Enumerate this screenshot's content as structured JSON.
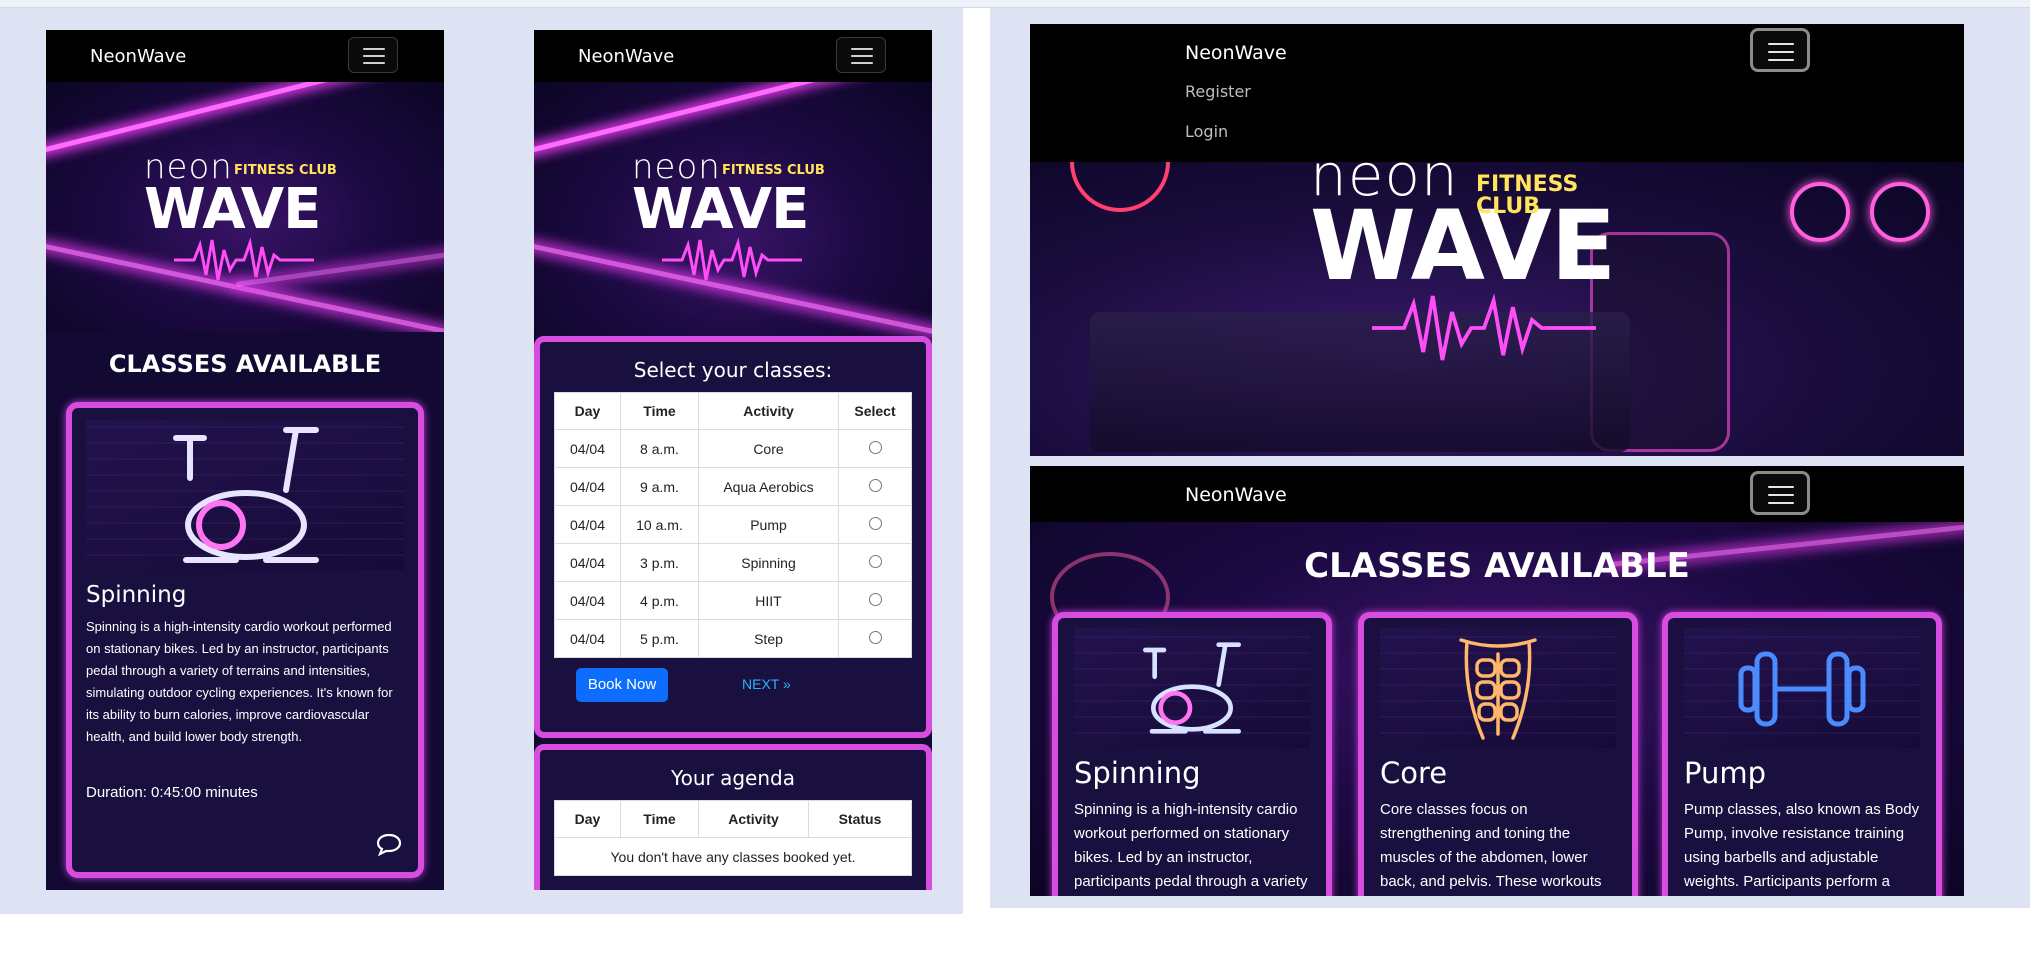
{
  "brand": "NeonWave",
  "logo": {
    "neon": "neon",
    "fitness_club": "FITNESS CLUB",
    "wave": "WAVE"
  },
  "nav_menu": {
    "register": "Register",
    "login": "Login"
  },
  "classes_heading": "CLASSES AVAILABLE",
  "classes": [
    {
      "title": "Spinning",
      "icon": "bike-icon",
      "description_full": "Spinning is a high-intensity cardio workout performed on stationary bikes. Led by an instructor, participants pedal through a variety of terrains and intensities, simulating outdoor cycling experiences. It's known for its ability to burn calories, improve cardiovascular health, and build lower body strength.",
      "description_short": "Spinning is a high-intensity cardio workout performed on stationary bikes. Led by an instructor, participants pedal through a variety",
      "duration": "Duration: 0:45:00 minutes"
    },
    {
      "title": "Core",
      "icon": "abs-icon",
      "description_short": "Core classes focus on strengthening and toning the muscles of the abdomen, lower back, and pelvis. These workouts"
    },
    {
      "title": "Pump",
      "icon": "dumbbell-icon",
      "description_short": "Pump classes, also known as Body Pump, involve resistance training using barbells and adjustable weights. Participants perform a"
    }
  ],
  "schedule": {
    "title": "Select your classes:",
    "headers": [
      "Day",
      "Time",
      "Activity",
      "Select"
    ],
    "rows": [
      [
        "04/04",
        "8 a.m.",
        "Core"
      ],
      [
        "04/04",
        "9 a.m.",
        "Aqua Aerobics"
      ],
      [
        "04/04",
        "10 a.m.",
        "Pump"
      ],
      [
        "04/04",
        "3 p.m.",
        "Spinning"
      ],
      [
        "04/04",
        "4 p.m.",
        "HIIT"
      ],
      [
        "04/04",
        "5 p.m.",
        "Step"
      ]
    ],
    "book_button": "Book Now",
    "next_link": "NEXT »"
  },
  "agenda": {
    "title": "Your agenda",
    "headers": [
      "Day",
      "Time",
      "Activity",
      "Status"
    ],
    "empty_message": "You don't have any classes booked yet."
  },
  "colors": {
    "accent": "#d64ddf",
    "panel_bg": "#1a1040",
    "button": "#0d6efd",
    "link": "#29b6f6",
    "logo_yellow": "#ffe45c"
  }
}
